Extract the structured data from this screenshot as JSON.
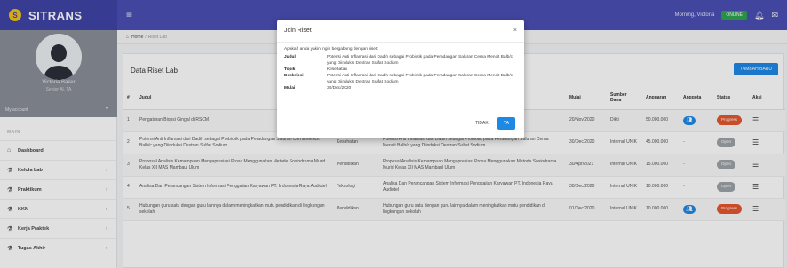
{
  "app": {
    "brand": "SITRANS",
    "logo_letter": "S"
  },
  "topbar": {
    "greeting": "Morning, Victoria",
    "status": "ONLINE",
    "menu_icon": "menu-icon",
    "notif_icon": "bell-icon",
    "chat_icon": "chat-icon"
  },
  "profile": {
    "name": "Victoria Baker",
    "role": "Senior Al, TA",
    "my_account": "My account"
  },
  "sidebar": {
    "header": "MAIN",
    "items": [
      {
        "label": "Dashboard",
        "icon": "home-icon"
      },
      {
        "label": "Kelola Lab",
        "icon": "flask-icon"
      },
      {
        "label": "Praktikum",
        "icon": "flask-icon"
      },
      {
        "label": "KKN",
        "icon": "flask-icon"
      },
      {
        "label": "Kerja Praktek",
        "icon": "flask-icon"
      },
      {
        "label": "Tugas Akhir",
        "icon": "flask-icon"
      }
    ]
  },
  "breadcrumb": {
    "home": "Home",
    "current": "Riset Lab"
  },
  "card": {
    "title": "Data Riset Lab",
    "add_button": "TAMBAH BARU"
  },
  "table": {
    "headers": {
      "no": "#",
      "judul": "Judul",
      "topik": "",
      "deskripsi": "",
      "mulai": "Mulai",
      "sumber": "Sumber Dana",
      "anggaran": "Anggaran",
      "anggota": "Anggota",
      "status": "Status",
      "aksi": "Aksi"
    },
    "rows": [
      {
        "no": "1",
        "judul": "Pengaturan Biopsi Gingal di RSCM",
        "topik": "",
        "deskripsi": "",
        "mulai": "20/Nov/2020",
        "sumber": "Dikti",
        "anggaran": "50.000.000",
        "anggota": "member",
        "status": "Progress",
        "status_color": "#e4572e"
      },
      {
        "no": "2",
        "judul": "Potensi Anti Inflamasi dari Dadih sebagai Probiotik pada Peradangan Saluran Cerna Mencit Balb/c yang Diinduksi Dextran Sulfat Sodium",
        "topik": "Kesehatan",
        "deskripsi": "Potensi Anti Inflamasi dari Dadih sebagai Probiotik pada Peradangan Saluran Cerna Mencit Balb/c yang Diinduksi Dextran Sulfat Sodium",
        "mulai": "30/Dec/2020",
        "sumber": "Internal UNIK",
        "anggaran": "45.000.000",
        "anggota": "-",
        "status": "Open",
        "status_color": "#9ea3a8"
      },
      {
        "no": "3",
        "judul": "Proposal Analisis Kemampuan Mengapresiasi Prosa Menggunakan Metode Sosiodrama Murid Kelas XII MAS Mambaul Ulum",
        "topik": "Pendidikan",
        "deskripsi": "Proposal Analisis Kemampuan Mengapresiasi Prosa Menggunakan Metode Sosiodrama Murid Kelas XII MAS Mambaul Ulum",
        "mulai": "30/Apr/2021",
        "sumber": "Internal UNIK",
        "anggaran": "15.000.000",
        "anggota": "-",
        "status": "Open",
        "status_color": "#9ea3a8"
      },
      {
        "no": "4",
        "judul": "Analisa Dan Perancangan Sistem Informasi Penggajian Karyawan PT. Indonesia Raya Audiotel",
        "topik": "Teknologi",
        "deskripsi": "Analisa Dan Perancangan Sistem Informasi Penggajian Karyawan PT. Indonesia Raya Audiotel",
        "mulai": "30/Dec/2020",
        "sumber": "Internal UNIK",
        "anggaran": "10.000.000",
        "anggota": "-",
        "status": "Open",
        "status_color": "#9ea3a8"
      },
      {
        "no": "5",
        "judul": "Hubungan guru satu dengan guru lainnya dalam meningkatkan mutu pendidikan di lingkungan sekolah",
        "topik": "Pendidikan",
        "deskripsi": "Hubungan guru satu dengan guru lainnya dalam meningkatkan mutu pendidikan di lingkungan sekolah",
        "mulai": "01/Dec/2020",
        "sumber": "Internal UNIK",
        "anggaran": "10.000.000",
        "anggota": "member",
        "status": "Progress",
        "status_color": "#e4572e"
      }
    ]
  },
  "modal": {
    "title": "Join Riset",
    "close": "×",
    "question": "Apakah anda yakin ingin bergabung dengan riset:",
    "fields": [
      {
        "key": "Judul",
        "value": "Potensi Anti Inflamasi dari Dadih sebagai Probiotik pada Peradangan Saluran Cerna Mencit Balb/c yang Diinduksi Dextran Sulfat Sodium"
      },
      {
        "key": "Topik",
        "value": "Kesehatan"
      },
      {
        "key": "Deskripsi",
        "value": "Potensi Anti Inflamasi dari Dadih sebagai Probiotik pada Peradangan Saluran Cerna Mencit Balb/c yang Diinduksi Dextran Sulfat Sodium"
      },
      {
        "key": "Mulai",
        "value": "30/Dec/2020"
      }
    ],
    "no_button": "TIDAK",
    "yes_button": "YA"
  },
  "colors": {
    "topbar": "#4a4fb4",
    "primary": "#1e88e5",
    "progress": "#e4572e",
    "open": "#9ea3a8"
  }
}
